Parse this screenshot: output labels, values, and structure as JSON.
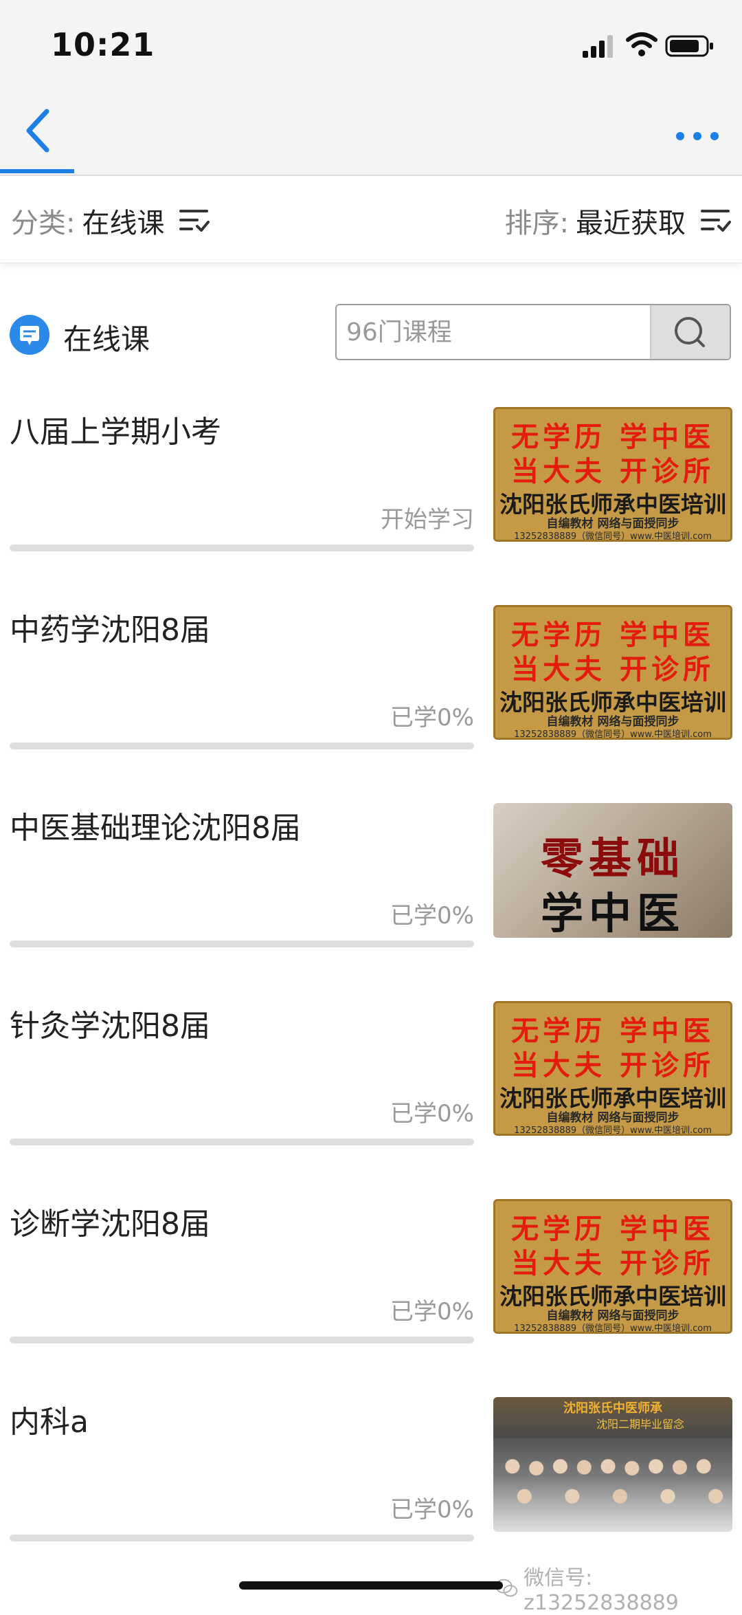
{
  "status_bar": {
    "time": "10:21"
  },
  "filter": {
    "category_key": "分类:",
    "category_value": "在线课",
    "sort_key": "排序:",
    "sort_value": "最近获取"
  },
  "section": {
    "title": "在线课",
    "search_placeholder": "96门课程"
  },
  "ad_text": {
    "line1": "无学历 学中医",
    "line2": "当大夫 开诊所",
    "line3": "沈阳张氏师承中医培训",
    "line4": "自编教材    网络与面授同步",
    "line5": "13252838889（微信同号）www.中医培训.com"
  },
  "zero_text": {
    "line1": "零基础",
    "line2": "学中医"
  },
  "group_text": {
    "line1": "沈阳张氏中医师承",
    "line2": "沈阳二期毕业留念"
  },
  "courses": [
    {
      "title": "八届上学期小考",
      "status": "开始学习",
      "progress": 0
    },
    {
      "title": "中药学沈阳8届",
      "status": "已学0%",
      "progress": 0
    },
    {
      "title": "中医基础理论沈阳8届",
      "status": "已学0%",
      "progress": 0
    },
    {
      "title": "针灸学沈阳8届",
      "status": "已学0%",
      "progress": 0
    },
    {
      "title": "诊断学沈阳8届",
      "status": "已学0%",
      "progress": 0
    },
    {
      "title": "内科a",
      "status": "已学0%",
      "progress": 0
    }
  ],
  "watermark": "微信号: z13252838889",
  "colors": {
    "accent": "#1e7ee8",
    "ad_red": "#e41b0f",
    "ad_bg": "#c49a46"
  }
}
